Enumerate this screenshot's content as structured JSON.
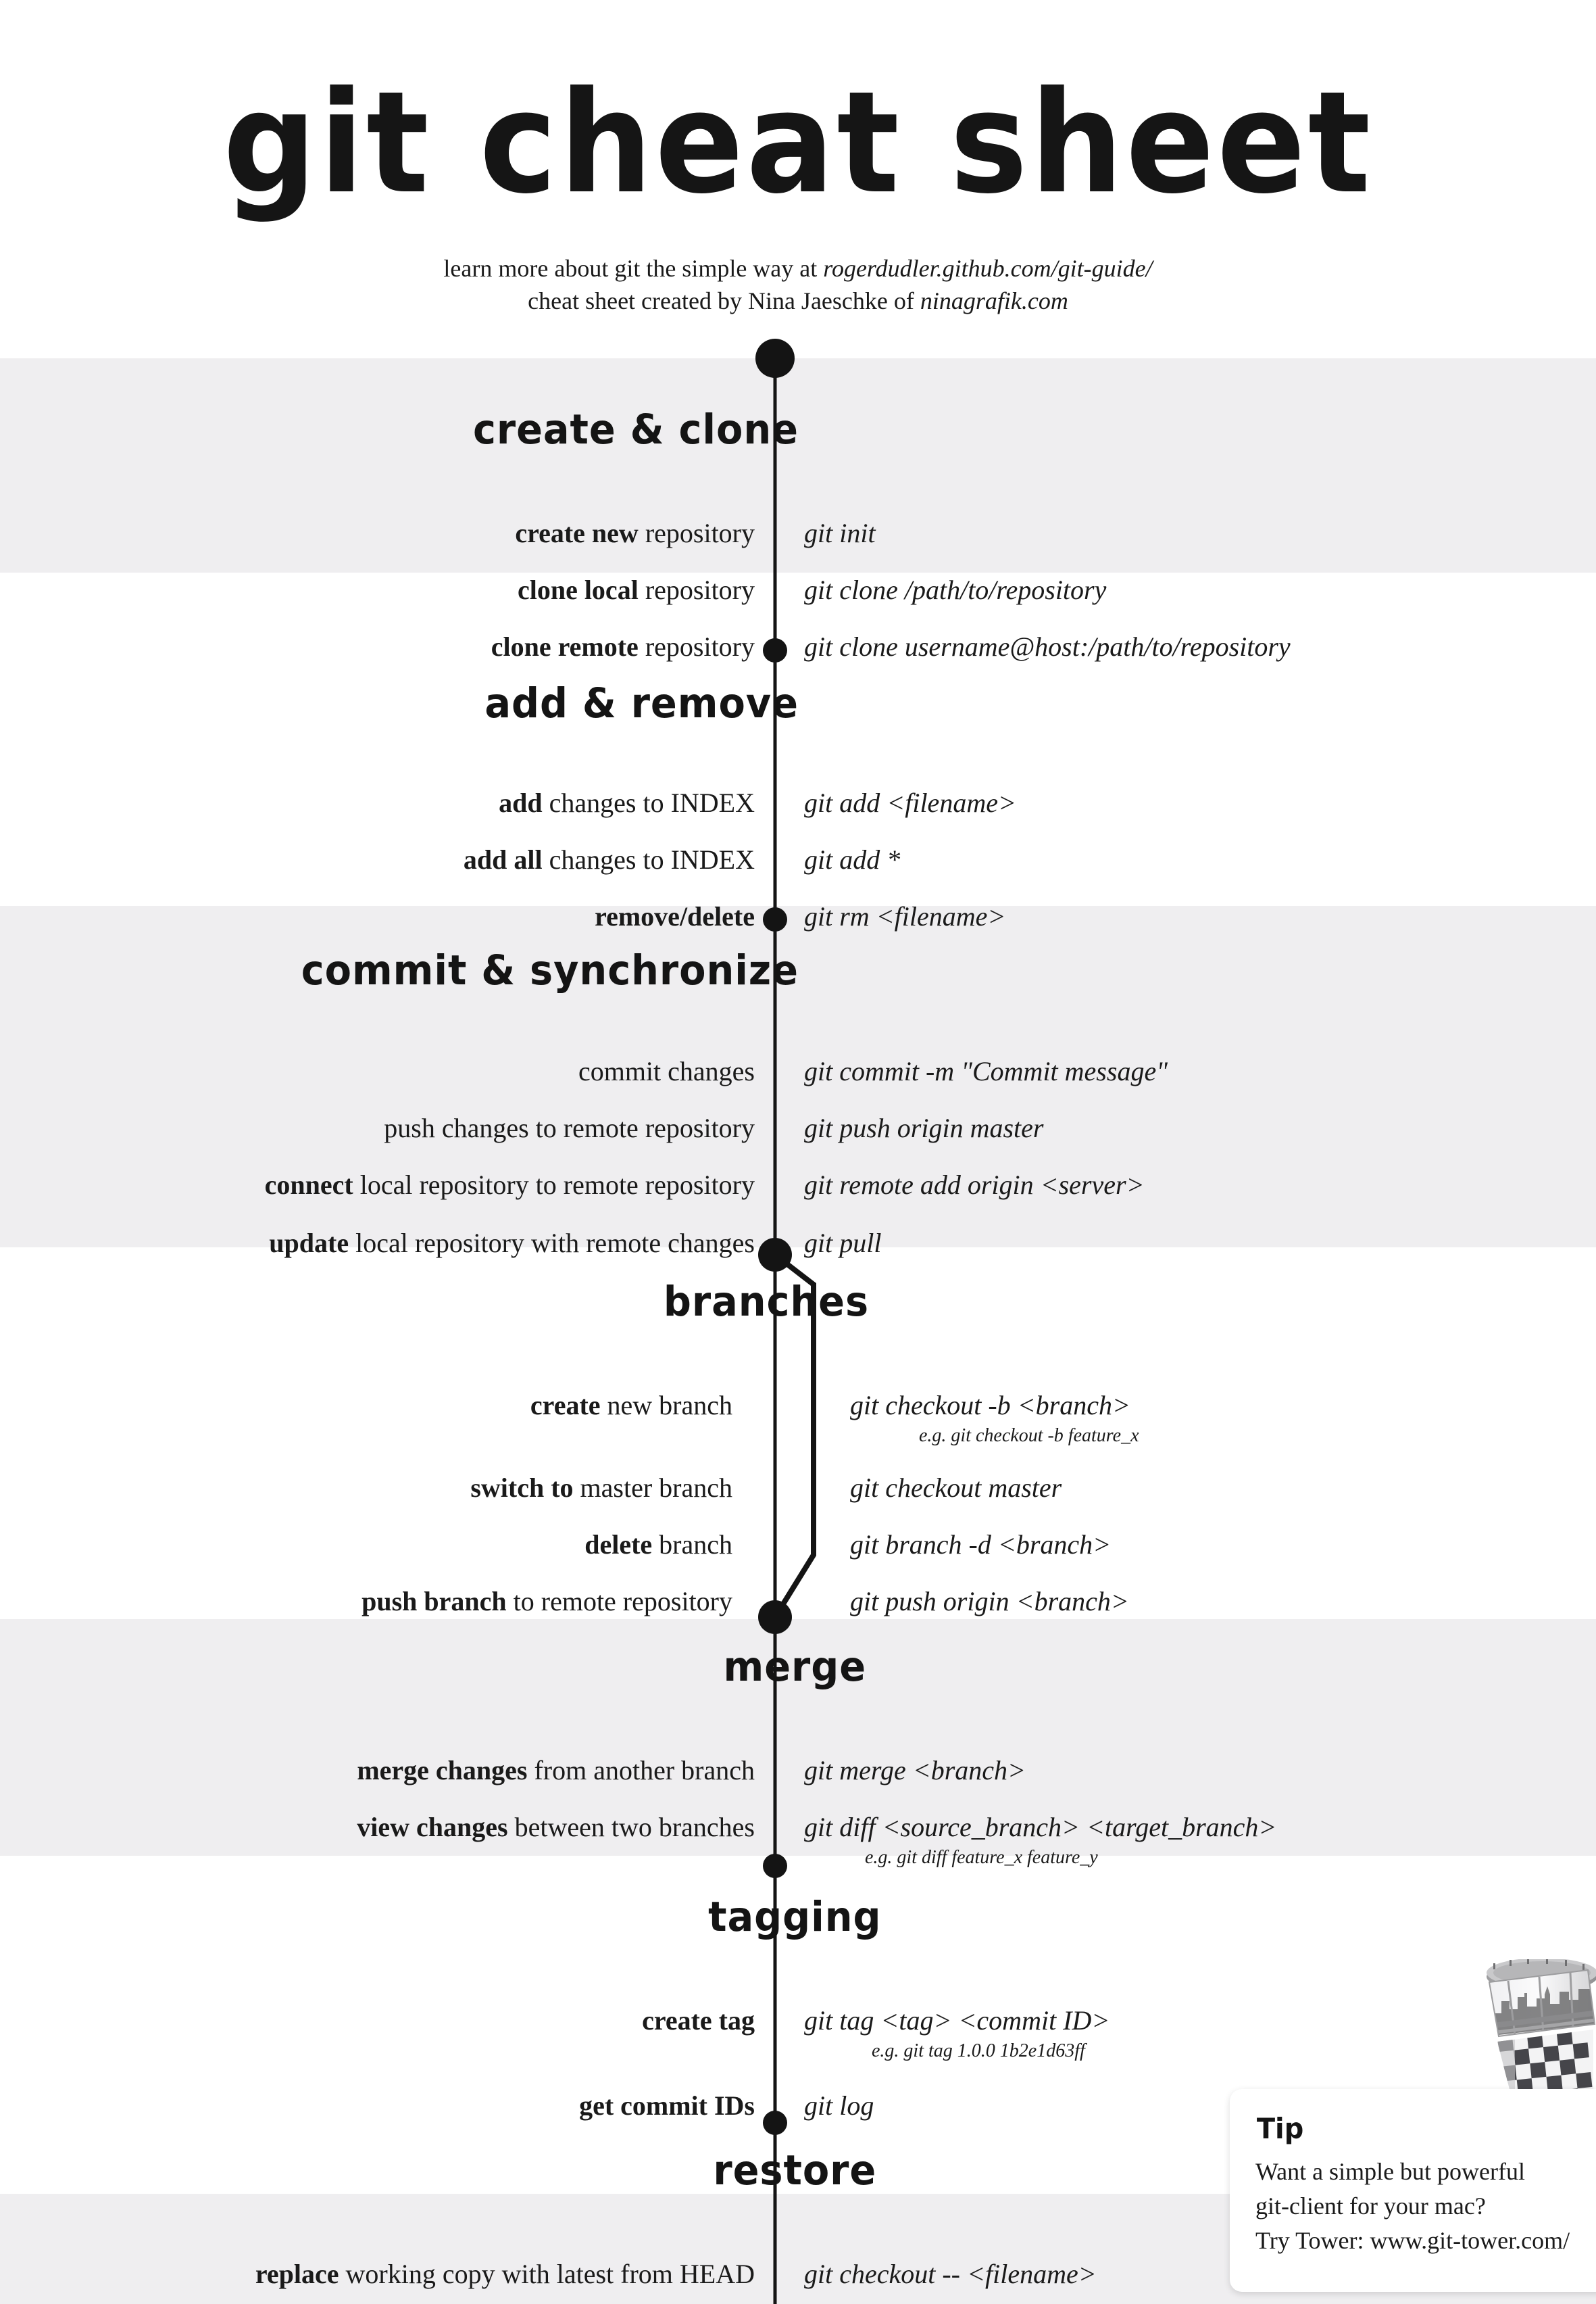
{
  "header": {
    "title": "git cheat sheet",
    "subtitle_line1_pre": "learn more about git the simple way at ",
    "subtitle_line1_link": "rogerdudler.github.com/git-guide/",
    "subtitle_line2_pre": "cheat sheet created by Nina Jaeschke of ",
    "subtitle_line2_link": "ninagrafik.com"
  },
  "sections": [
    {
      "id": "create-clone",
      "heading": "create & clone",
      "rows": [
        {
          "label_bold": "create new",
          "label_rest": " repository",
          "command": "git init"
        },
        {
          "label_bold": "clone local",
          "label_rest": " repository",
          "command": "git clone /path/to/repository"
        },
        {
          "label_bold": "clone remote",
          "label_rest": " repository",
          "command": "git clone username@host:/path/to/repository"
        }
      ]
    },
    {
      "id": "add-remove",
      "heading": "add & remove",
      "rows": [
        {
          "label_bold": "add",
          "label_rest": " changes to INDEX",
          "command": "git add <filename>"
        },
        {
          "label_bold": "add all",
          "label_rest": " changes to INDEX",
          "command": "git add *"
        },
        {
          "label_bold": "remove/delete",
          "label_rest": "",
          "command": "git rm <filename>"
        }
      ]
    },
    {
      "id": "commit-synchronize",
      "heading": "commit & synchronize",
      "rows": [
        {
          "label_bold": "",
          "label_rest": "commit changes",
          "command": "git commit -m \"Commit message\""
        },
        {
          "label_bold": "",
          "label_rest": "push changes to remote repository",
          "command": "git push origin master"
        },
        {
          "label_bold": "connect",
          "label_rest": " local repository to remote repository",
          "command": "git remote add origin <server>"
        },
        {
          "label_bold": "update",
          "label_rest": " local repository with remote changes",
          "command": "git pull"
        }
      ]
    },
    {
      "id": "branches",
      "heading": "branches",
      "rows": [
        {
          "label_bold": "create",
          "label_rest": " new branch",
          "command": "git checkout -b <branch>",
          "example": "e.g. git checkout -b feature_x"
        },
        {
          "label_bold": "switch to",
          "label_rest": " master branch",
          "command": "git checkout master"
        },
        {
          "label_bold": "delete",
          "label_rest": " branch",
          "command": "git branch -d <branch>"
        },
        {
          "label_bold": "push branch",
          "label_rest": " to remote repository",
          "command": "git push origin <branch>"
        }
      ]
    },
    {
      "id": "merge",
      "heading": "merge",
      "rows": [
        {
          "label_bold": "merge changes",
          "label_rest": " from another branch",
          "command": "git merge <branch>"
        },
        {
          "label_bold": "view changes",
          "label_rest": " between two branches",
          "command": "git diff <source_branch> <target_branch>",
          "example": "e.g. git diff feature_x feature_y"
        }
      ]
    },
    {
      "id": "tagging",
      "heading": "tagging",
      "rows": [
        {
          "label_bold": "create tag",
          "label_rest": "",
          "command": "git tag <tag> <commit ID>",
          "example": "e.g. git tag 1.0.0 1b2e1d63ff"
        },
        {
          "label_bold": "get commit IDs",
          "label_rest": "",
          "command": "git log"
        }
      ]
    },
    {
      "id": "restore",
      "heading": "restore",
      "rows": [
        {
          "label_bold": "replace",
          "label_rest": " working copy with latest from HEAD",
          "command": "git checkout -- <filename>"
        }
      ]
    }
  ],
  "tip": {
    "title": "Tip",
    "line1": "Want a simple but powerful",
    "line2": "git-client for your mac?",
    "line3": "Try Tower: www.git-tower.com/"
  },
  "colors": {
    "band": "#efeef0",
    "page": "#ffffff",
    "ink": "#141414"
  }
}
